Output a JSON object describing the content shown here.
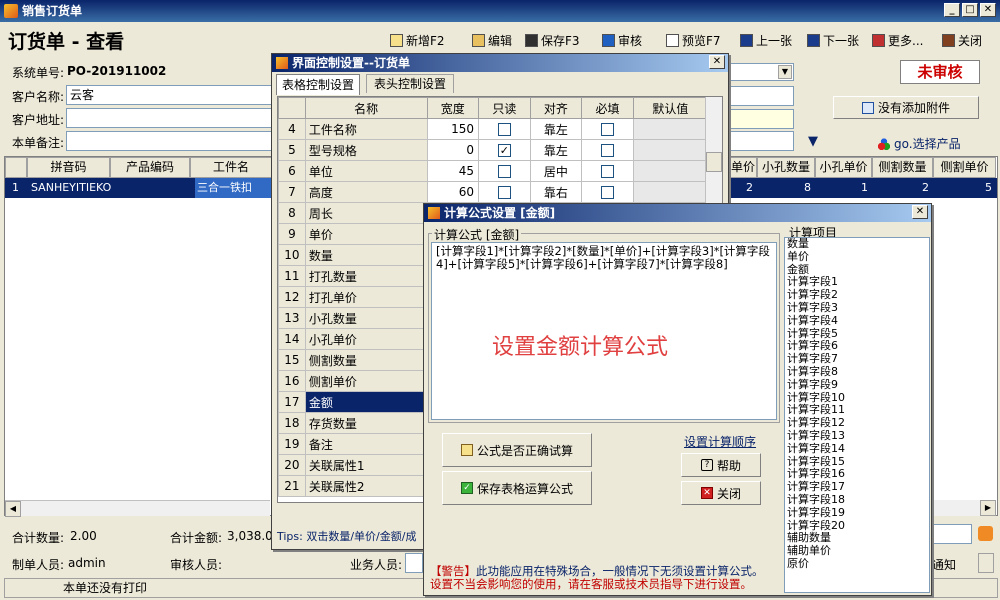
{
  "window": {
    "title": "销售订货单"
  },
  "header": {
    "title": "订货单 - 查看",
    "toolbar": [
      {
        "label": "新增F2",
        "icon": "new-doc-icon"
      },
      {
        "label": "编辑",
        "icon": "edit-icon"
      },
      {
        "label": "保存F3",
        "icon": "save-icon"
      },
      {
        "label": "审核",
        "icon": "check-icon"
      },
      {
        "label": "预览F7",
        "icon": "preview-icon"
      },
      {
        "label": "上一张",
        "icon": "prev-icon"
      },
      {
        "label": "下一张",
        "icon": "next-icon"
      },
      {
        "label": "更多...",
        "icon": "more-icon"
      },
      {
        "label": "关闭",
        "icon": "exit-icon"
      }
    ],
    "status": "未审核"
  },
  "form": {
    "order_no_label": "系统单号:",
    "order_no": "PO-201911002",
    "customer_label": "客户名称:",
    "customer": "云客",
    "address_label": "客户地址:",
    "remark_label": "本单备注:",
    "attach_button": "没有添加附件",
    "select_product": "go.选择产品"
  },
  "main_grid": {
    "columns": [
      "拼音码",
      "产品编码",
      "工件名"
    ],
    "right_columns": [
      "单价",
      "小孔数量",
      "小孔单价",
      "侧割数量",
      "侧割单价"
    ],
    "row": {
      "index": "1",
      "pinyin": "SANHEYITIEKO",
      "code": "",
      "name": "三合一铁扣",
      "right": [
        "2",
        "8",
        "1",
        "2",
        "5"
      ]
    }
  },
  "footer": {
    "total_qty_label": "合计数量:",
    "total_qty": "2.00",
    "total_amt_label": "合计金额:",
    "total_amt": "3,038.0",
    "maker_label": "制单人员:",
    "maker": "admin",
    "auditor_label": "审核人员:",
    "sales_label": "业务人员:",
    "notify": "通知",
    "print_status": "本单还没有打印"
  },
  "ui_panel": {
    "title": "界面控制设置--订货单",
    "tabs": [
      "表格控制设置",
      "表头控制设置"
    ],
    "headers": [
      "名称",
      "宽度",
      "只读",
      "对齐",
      "必填",
      "默认值"
    ],
    "rows": [
      {
        "n": "4",
        "name": "工件名称",
        "width": "150",
        "ro": false,
        "align": "靠左",
        "req": false
      },
      {
        "n": "5",
        "name": "型号规格",
        "width": "0",
        "ro": true,
        "align": "靠左",
        "req": false
      },
      {
        "n": "6",
        "name": "单位",
        "width": "45",
        "ro": false,
        "align": "居中",
        "req": false
      },
      {
        "n": "7",
        "name": "高度",
        "width": "60",
        "ro": false,
        "align": "靠右",
        "req": false
      },
      {
        "n": "8",
        "name": "周长"
      },
      {
        "n": "9",
        "name": "单价"
      },
      {
        "n": "10",
        "name": "数量"
      },
      {
        "n": "11",
        "name": "打孔数量"
      },
      {
        "n": "12",
        "name": "打孔单价"
      },
      {
        "n": "13",
        "name": "小孔数量"
      },
      {
        "n": "14",
        "name": "小孔单价"
      },
      {
        "n": "15",
        "name": "侧割数量"
      },
      {
        "n": "16",
        "name": "侧割单价"
      },
      {
        "n": "17",
        "name": "金额",
        "selected": true
      },
      {
        "n": "18",
        "name": "存货数量"
      },
      {
        "n": "19",
        "name": "备注"
      },
      {
        "n": "20",
        "name": "关联属性1"
      },
      {
        "n": "21",
        "name": "关联属性2"
      }
    ],
    "tips": "Tips: 双击数量/单价/金额/成"
  },
  "formula_panel": {
    "title": "计算公式设置 [金额]",
    "group_label": "计算公式 [金额]",
    "formula": "[计算字段1]*[计算字段2]*[数量]*[单价]+[计算字段3]*[计算字段4]+[计算字段5]*[计算字段6]+[计算字段7]*[计算字段8]",
    "watermark": "设置金额计算公式",
    "btn_test": "公式是否正确试算",
    "btn_save": "保存表格运算公式",
    "link_order": "设置计算顺序",
    "btn_help": "帮助",
    "btn_close": "关闭",
    "items_label": "计算项目",
    "items": [
      "数量",
      "单价",
      "金额",
      "计算字段1",
      "计算字段2",
      "计算字段3",
      "计算字段4",
      "计算字段5",
      "计算字段6",
      "计算字段7",
      "计算字段8",
      "计算字段9",
      "计算字段10",
      "计算字段11",
      "计算字段12",
      "计算字段13",
      "计算字段14",
      "计算字段15",
      "计算字段16",
      "计算字段17",
      "计算字段18",
      "计算字段19",
      "计算字段20",
      "辅助数量",
      "辅助单价",
      "原价"
    ],
    "warning_tag": "【警告】",
    "warning_line1": "此功能应用在特殊场合，一般情况下无须设置计算公式。",
    "warning_line2": "设置不当会影响您的使用，请在客服或技术员指导下进行设置。"
  }
}
